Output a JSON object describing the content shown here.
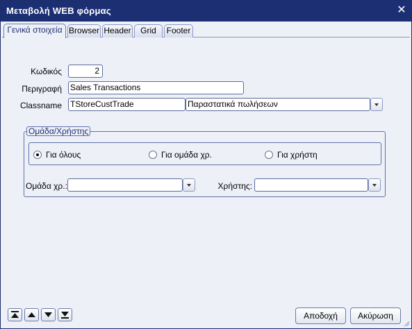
{
  "window": {
    "title": "Μεταβολή  WEB φόρμας",
    "close_symbol": "✕"
  },
  "tabs": [
    {
      "label": "Γενικά στοιχεία",
      "active": true
    },
    {
      "label": "Browser",
      "active": false
    },
    {
      "label": "Header",
      "active": false
    },
    {
      "label": "Grid",
      "active": false
    },
    {
      "label": "Footer",
      "active": false
    }
  ],
  "form": {
    "code_label": "Κωδικός",
    "code_value": "2",
    "description_label": "Περιγραφή",
    "description_value": "Sales Transactions",
    "classname_label": "Classname",
    "classname_value": "TStoreCustTrade",
    "classname_desc_value": "Παραστατικά πωλήσεων"
  },
  "group": {
    "legend": "Ομάδα/Χρήστης",
    "radios": [
      {
        "label": "Για όλους",
        "checked": true
      },
      {
        "label": "Για ομάδα χρ.",
        "checked": false
      },
      {
        "label": "Για χρήστη",
        "checked": false
      }
    ],
    "user_group_label": "Ομάδα χρ.:",
    "user_group_value": "",
    "user_label": "Χρήστης:",
    "user_value": ""
  },
  "nav_buttons": [
    "first-icon",
    "up-icon",
    "down-icon",
    "last-icon"
  ],
  "buttons": {
    "ok_label": "Αποδοχή",
    "cancel_label": "Ακύρωση"
  },
  "colors": {
    "titlebar": "#1c2f72",
    "panel": "#eef0f8",
    "accent": "#5e72a8"
  }
}
